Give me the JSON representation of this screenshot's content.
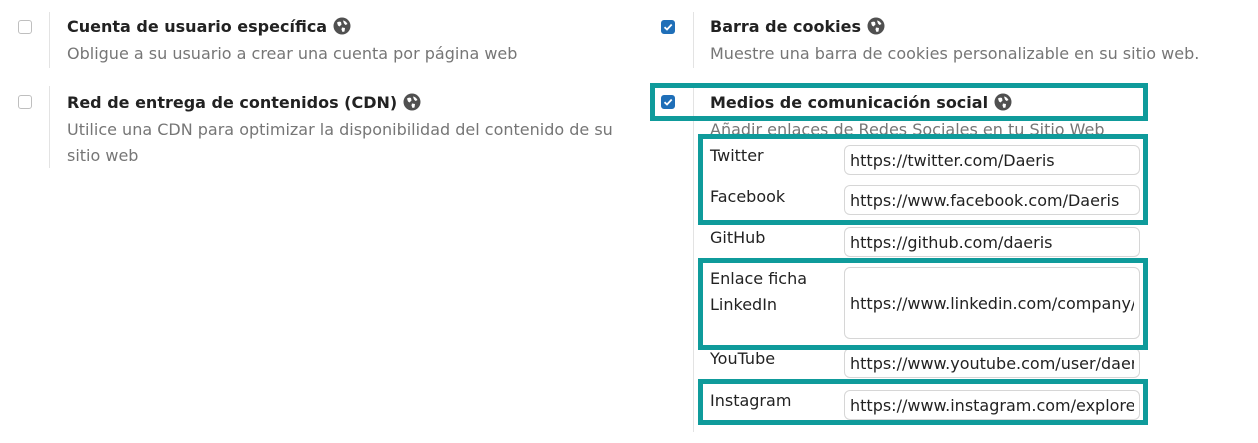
{
  "options": {
    "custom_account": {
      "title": "Cuenta de usuario específica",
      "description": "Obligue a su usuario a crear una cuenta por página web",
      "checked": false
    },
    "cookie_bar": {
      "title": "Barra de cookies",
      "description": "Muestre una barra de cookies personalizable en su sitio web.",
      "checked": true
    },
    "cdn": {
      "title": "Red de entrega de contenidos (CDN)",
      "description": "Utilice una CDN para optimizar la disponibilidad del contenido de su sitio web",
      "checked": false
    },
    "social_media": {
      "title": "Medios de comunicación social",
      "description": "Añadir enlaces de Redes Sociales en tu Sitio Web",
      "checked": true
    }
  },
  "social_links": [
    {
      "label": "Twitter",
      "value": "https://twitter.com/Daeris"
    },
    {
      "label": "Facebook",
      "value": "https://www.facebook.com/Daeris"
    },
    {
      "label": "GitHub",
      "value": "https://github.com/daeris"
    },
    {
      "label": "Enlace ficha LinkedIn",
      "value": "https://www.linkedin.com/company/daeris"
    },
    {
      "label": "YouTube",
      "value": "https://www.youtube.com/user/daeris"
    },
    {
      "label": "Instagram",
      "value": "https://www.instagram.com/explore"
    }
  ],
  "icons": {
    "globe": "globe-icon",
    "check": "check-icon"
  },
  "colors": {
    "checkbox_checked": "#1f6fb8",
    "highlight": "#0f9b9b"
  }
}
